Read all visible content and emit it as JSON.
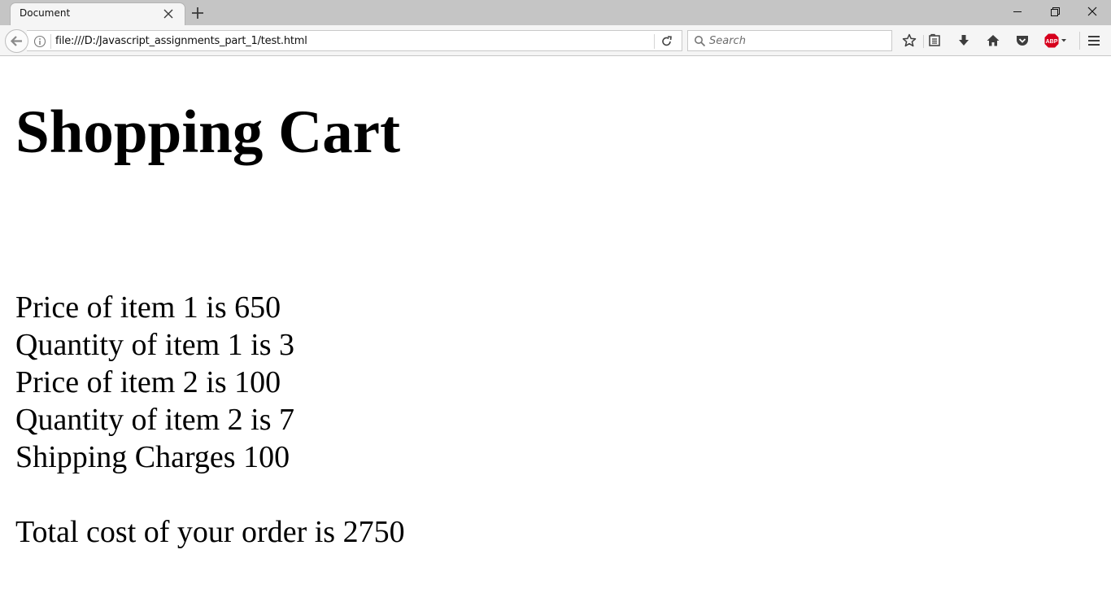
{
  "browser": {
    "tab_title": "Document",
    "url": "file:///D:/Javascript_assignments_part_1/test.html",
    "search_placeholder": "Search",
    "abp_label": "ABP"
  },
  "page": {
    "title": "Shopping Cart",
    "lines": [
      "Price of item 1 is 650",
      "Quantity of item 1 is 3",
      "Price of item 2 is 100",
      "Quantity of item 2 is 7",
      "Shipping Charges 100"
    ],
    "total": "Total cost of your order is 2750"
  },
  "colors": {
    "chrome_bg": "#c5c5c5",
    "toolbar_bg": "#f5f5f5",
    "abp_red": "#d6001c"
  }
}
